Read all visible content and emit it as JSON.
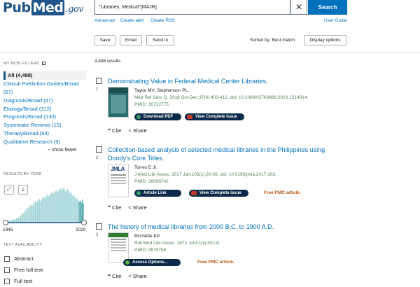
{
  "header": {
    "logo_pub": "Pub",
    "logo_med": "Med",
    "logo_gov": ".gov",
    "search_value": "\"Libraries, Medical\"[MAJR]",
    "search_label": "Search",
    "links": [
      "Advanced",
      "Create alert",
      "Create RSS"
    ],
    "user_guide": "User Guide"
  },
  "toolbar": {
    "save": "Save",
    "email": "Email",
    "send_to": "Send to",
    "sorted_by": "Sorted by: Best match",
    "display_options": "Display options"
  },
  "sidebar": {
    "filters_heading": "MY NCBI FILTERS",
    "filters": [
      "All (4,488)",
      "Clinical Prediction Guides/Broad",
      "(67)",
      "Diagnosis/Broad (47)",
      "Etiology/Broad (312)",
      "Prognosis/Broad (130)",
      "Systematic Reviews (15)",
      "Therapy/Broad (63)",
      "Qualitative Research (5)"
    ],
    "show_fewer": "show fewer",
    "year_heading": "RESULTS BY YEAR",
    "year_start": "1945",
    "year_end": "2020",
    "text_avail_heading": "TEXT AVAILABILITY",
    "text_options": [
      "Abstract",
      "Free full text",
      "Full text"
    ]
  },
  "results_count": "4,488 results",
  "results": [
    {
      "number": "1",
      "title": "Demonstrating Value in Federal Medical Center Libraries.",
      "authors": "Taylor MV, Stephenson PL.",
      "citation": "Med Ref Serv Q. 2018 Oct-Dec;37(4):403-412. doi: 10.1080/02763869.2018.1514914.",
      "pmid": "PMID: 30722775",
      "buttons": [
        "Download PDF",
        "View Complete Issue"
      ],
      "free_pmc": ""
    },
    {
      "number": "2",
      "title": "Collection-based analysis of selected medical libraries in the Philippines using Doody's Core Titles.",
      "authors": "Torres E Jr.",
      "citation": "J Med Libr Assoc. 2017 Jan;105(1):20-26. doi: 10.5195/jmla.2017.103.",
      "pmid": "PMID: 28096742",
      "buttons": [
        "Article Link",
        "View Complete Issue"
      ],
      "free_pmc": "Free PMC article."
    },
    {
      "number": "3",
      "title": "The history of medical libraries from 2000 B.C. to 1900 A.D.",
      "authors": "Birchette KP.",
      "citation": "Bull Med Libr Assoc. 1973 Jul;61(3):302-8.",
      "pmid": "PMID: 4579768",
      "buttons": [
        "Access Options..."
      ],
      "free_pmc": "Free PMC article."
    }
  ],
  "actions": {
    "cite": "Cite",
    "share": "Share"
  },
  "thumbs": {
    "jmla": "JMLA"
  },
  "chart_data": {
    "type": "bar",
    "x_range": [
      1945,
      2020
    ],
    "values": [
      2,
      2,
      3,
      3,
      4,
      4,
      5,
      5,
      6,
      6,
      7,
      8,
      9,
      10,
      12,
      14,
      16,
      18,
      20,
      22,
      24,
      26,
      28,
      30,
      32,
      30,
      33,
      36,
      38,
      35,
      37,
      40,
      42,
      38,
      41,
      44,
      46,
      43,
      45,
      48,
      50,
      47,
      49,
      52,
      55,
      51,
      53,
      56,
      58,
      54,
      56,
      59,
      61,
      57,
      60,
      62,
      58,
      55,
      57,
      60,
      56,
      52,
      54,
      50,
      47,
      49,
      45,
      42,
      44,
      40,
      37,
      39,
      36,
      41,
      34
    ]
  },
  "colors": {
    "brand": "#20558a",
    "link": "#0071bc",
    "search_button": "#0071bc",
    "citation_green": "#4d8055",
    "free_pmc": "#b5530b",
    "chart_bar": "#9fd3d6",
    "chart_bar_dark": "#4aa3a8"
  }
}
